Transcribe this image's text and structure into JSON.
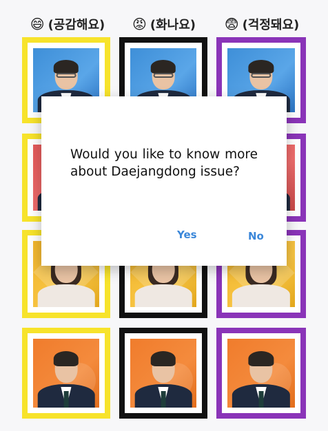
{
  "columns": [
    {
      "emoji": "😄",
      "label": "(공감해요)",
      "border_color": "#f7e32b"
    },
    {
      "emoji": "😡",
      "label": "(화나요)",
      "border_color": "#111111"
    },
    {
      "emoji": "😨",
      "label": "(걱정돼요)",
      "border_color": "#8a34b8"
    }
  ],
  "rows": [
    {
      "background": "blue",
      "figure": "man-glasses"
    },
    {
      "background": "red",
      "figure": "man-glasses"
    },
    {
      "background": "yellow",
      "figure": "woman"
    },
    {
      "background": "orange",
      "figure": "man"
    }
  ],
  "dialog": {
    "message": "Would you like to know more about Daejangdong issue?",
    "yes_label": "Yes",
    "no_label": "No",
    "button_color": "#3b87d9"
  }
}
